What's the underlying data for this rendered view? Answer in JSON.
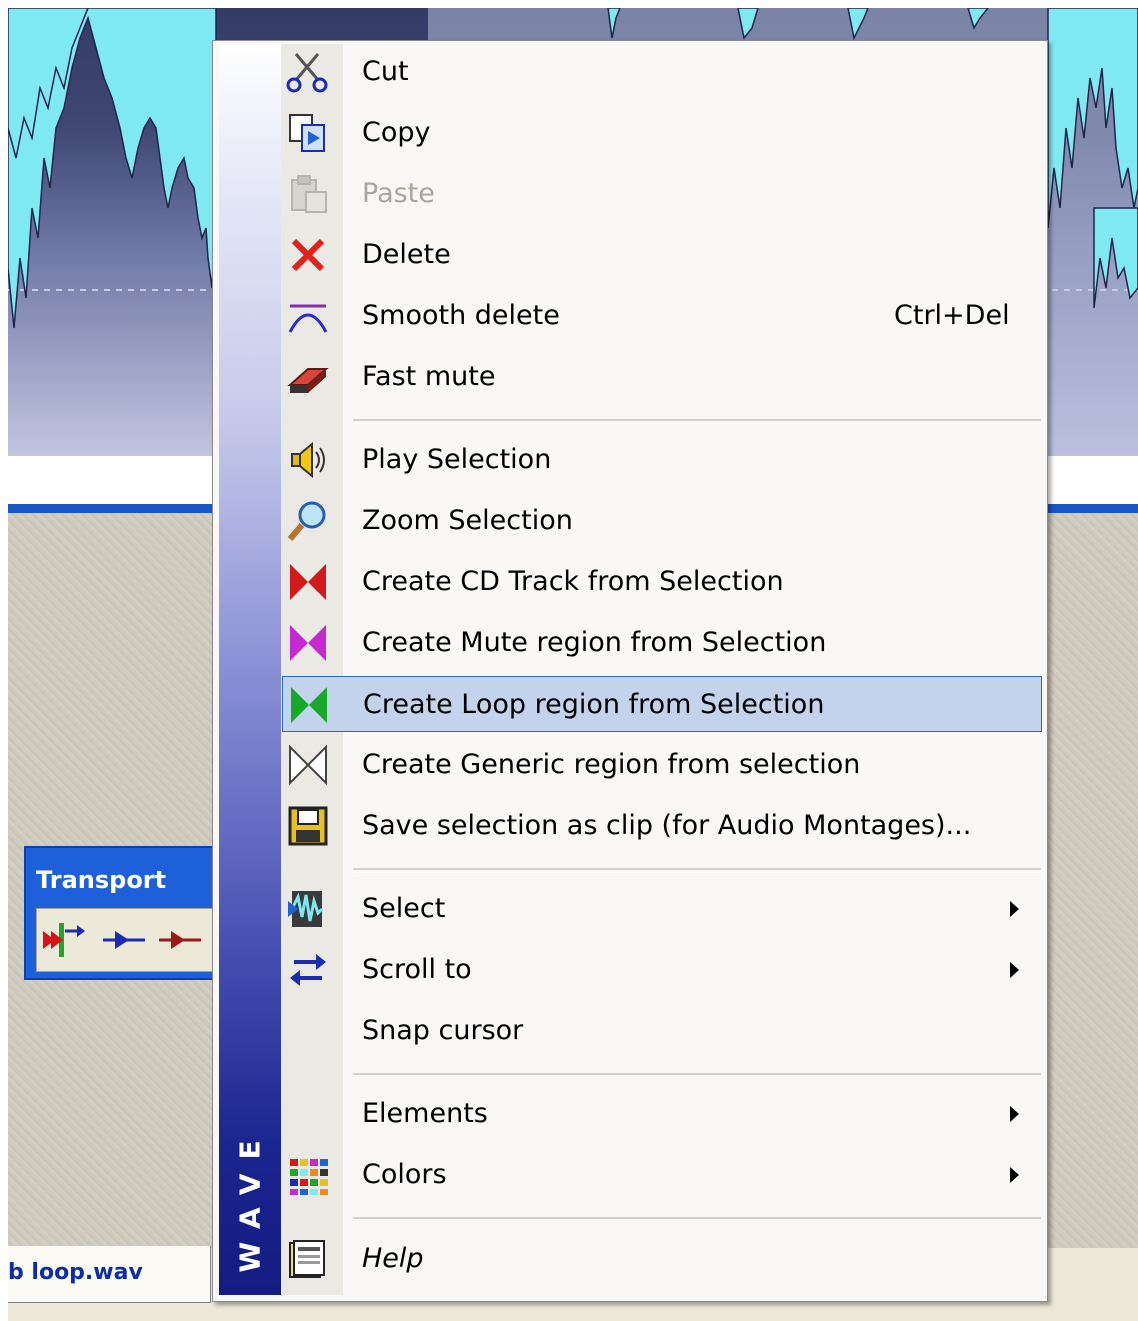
{
  "colors": {
    "menu_highlight": "#c4d3ec",
    "highlight_border": "#3065c4",
    "waveform": "#7fe9f1",
    "disabled_text": "#a8a69e",
    "titlebar_blue": "#1e60d9"
  },
  "transport": {
    "title": "Transport",
    "icons": [
      "go-to-start-icon",
      "play-arrow-icon",
      "play-arrow-red-icon"
    ]
  },
  "file_tab": {
    "label": "b loop.wav"
  },
  "menu": {
    "sidebar_label": "WAVE",
    "items": [
      {
        "label": "Cut",
        "icon": "scissors-icon",
        "shortcut": "",
        "enabled": true
      },
      {
        "label": "Copy",
        "icon": "copy-icon",
        "shortcut": "",
        "enabled": true
      },
      {
        "label": "Paste",
        "icon": "paste-icon",
        "shortcut": "",
        "enabled": false
      },
      {
        "label": "Delete",
        "icon": "delete-x-icon",
        "shortcut": "",
        "enabled": true
      },
      {
        "label": "Smooth delete",
        "icon": "smooth-delete-icon",
        "shortcut": "Ctrl+Del",
        "enabled": true
      },
      {
        "label": "Fast mute",
        "icon": "eraser-icon",
        "shortcut": "",
        "enabled": true
      },
      {
        "label": "Play Selection",
        "icon": "speaker-icon",
        "shortcut": "",
        "enabled": true
      },
      {
        "label": "Zoom Selection",
        "icon": "magnifier-icon",
        "shortcut": "",
        "enabled": true
      },
      {
        "label": "Create CD Track from Selection",
        "icon": "cd-track-marker-icon",
        "shortcut": "",
        "enabled": true
      },
      {
        "label": "Create Mute region from Selection",
        "icon": "mute-region-marker-icon",
        "shortcut": "",
        "enabled": true
      },
      {
        "label": "Create Loop region from Selection",
        "icon": "loop-region-marker-icon",
        "shortcut": "",
        "enabled": true,
        "highlighted": true
      },
      {
        "label": "Create Generic region from selection",
        "icon": "generic-region-marker-icon",
        "shortcut": "",
        "enabled": true
      },
      {
        "label": "Save selection as clip (for Audio Montages)...",
        "icon": "floppy-disk-icon",
        "shortcut": "",
        "enabled": true
      },
      {
        "label": "Select",
        "icon": "select-wave-icon",
        "submenu": true,
        "enabled": true
      },
      {
        "label": "Scroll to",
        "icon": "scroll-arrows-icon",
        "submenu": true,
        "enabled": true
      },
      {
        "label": "Snap cursor",
        "icon": "",
        "shortcut": "",
        "enabled": true
      },
      {
        "label": "Elements",
        "icon": "",
        "submenu": true,
        "enabled": true
      },
      {
        "label": "Colors",
        "icon": "color-grid-icon",
        "submenu": true,
        "enabled": true
      },
      {
        "label": "Help",
        "icon": "help-book-icon",
        "shortcut": "",
        "enabled": true,
        "italic": true
      }
    ]
  }
}
